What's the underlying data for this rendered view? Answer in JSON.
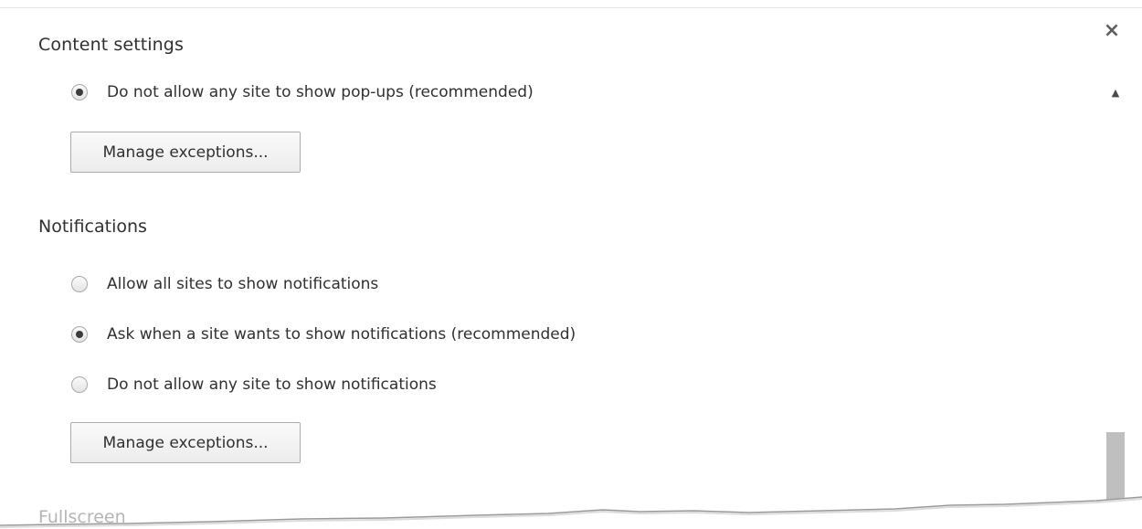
{
  "dialog": {
    "title": "Content settings",
    "close_label": "×",
    "close_icon": "close-icon"
  },
  "popups": {
    "selected_option": "Do not allow any site to show pop-ups (recommended)",
    "options": [
      {
        "label": "Do not allow any site to show pop-ups (recommended)",
        "checked": true
      }
    ],
    "manage_button": "Manage exceptions..."
  },
  "notifications": {
    "title": "Notifications",
    "options": [
      {
        "label": "Allow all sites to show notifications",
        "checked": false
      },
      {
        "label": "Ask when a site wants to show notifications (recommended)",
        "checked": true
      },
      {
        "label": "Do not allow any site to show notifications",
        "checked": false
      }
    ],
    "manage_button": "Manage exceptions..."
  },
  "fullscreen": {
    "title": "Fullscreen"
  },
  "scrollbar": {
    "up_arrow": "▲",
    "up_icon": "scroll-up-arrow-icon"
  },
  "colors": {
    "text": "#303030",
    "faded_text": "#b5b5b5",
    "scroll_thumb": "#bfbfbf",
    "button_border": "#acacac"
  }
}
